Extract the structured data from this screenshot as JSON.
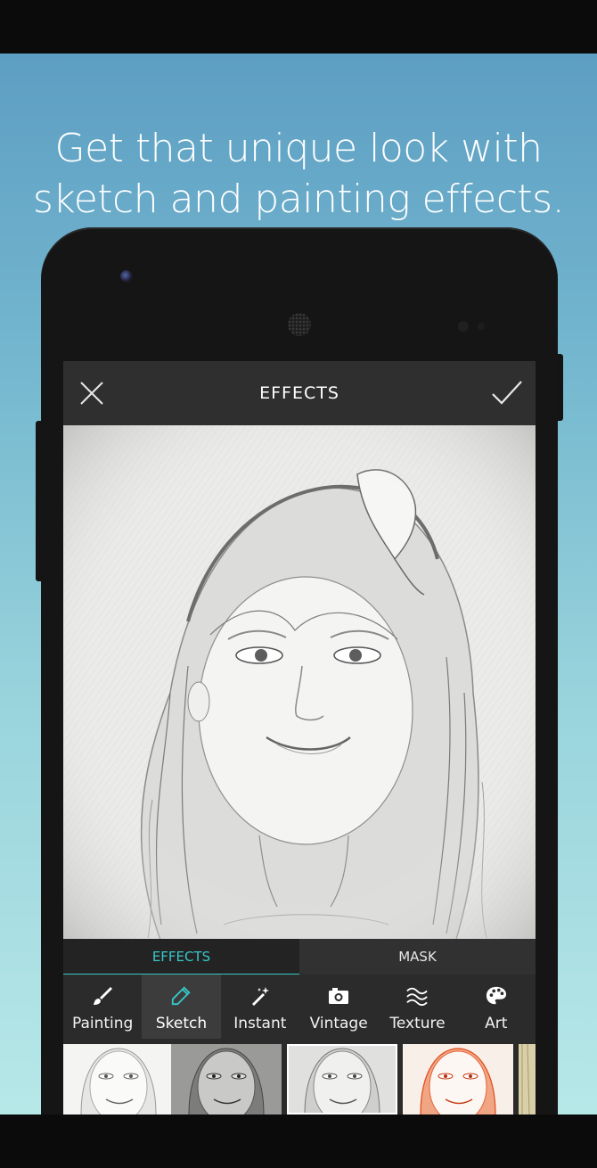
{
  "headline": {
    "line1": "Get that unique look with",
    "line2": "sketch and painting effects."
  },
  "app": {
    "title": "EFFECTS",
    "close_icon": "close-icon",
    "confirm_icon": "check-icon",
    "segments": [
      {
        "label": "EFFECTS",
        "active": true
      },
      {
        "label": "MASK",
        "active": false
      }
    ],
    "tools": [
      {
        "label": "Painting",
        "icon": "brush-icon",
        "active": false
      },
      {
        "label": "Sketch",
        "icon": "pencil-icon",
        "active": true
      },
      {
        "label": "Instant",
        "icon": "magic-wand-icon",
        "active": false
      },
      {
        "label": "Vintage",
        "icon": "camera-icon",
        "active": false
      },
      {
        "label": "Texture",
        "icon": "waves-icon",
        "active": false
      },
      {
        "label": "Art",
        "icon": "palette-icon",
        "active": false
      }
    ],
    "thumbnails": [
      {
        "style": "sketch-light"
      },
      {
        "style": "sketch-gray"
      },
      {
        "style": "sketch-selected",
        "selected": true
      },
      {
        "style": "sketch-red"
      },
      {
        "style": "sketch-sepia"
      }
    ]
  },
  "colors": {
    "accent": "#37c8c8",
    "bg_top": "#5d9ec3",
    "bg_bottom": "#b7e8e8"
  }
}
